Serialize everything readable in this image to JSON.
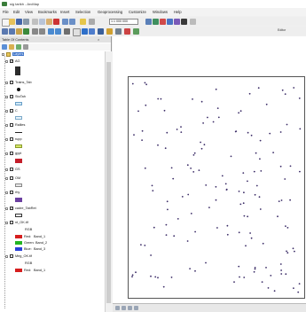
{
  "window": {
    "title": "sig tarikh - ArcMap"
  },
  "menu": [
    "File",
    "Edit",
    "View",
    "Bookmarks",
    "Insert",
    "Selection",
    "Geoprocessing",
    "Customize",
    "Windows",
    "Help"
  ],
  "toolbar": {
    "scale": "1:1 000 000",
    "editor_label": "Editor"
  },
  "toc": {
    "title": "Table Of Contents",
    "close": "×",
    "root": "Layers",
    "layers": [
      {
        "name": "AG",
        "checked": true
      },
      {
        "name": "Trains_Tab",
        "checked": false
      },
      {
        "name": "StoTah",
        "checked": false
      },
      {
        "name": "C",
        "checked": false
      },
      {
        "name": "Rallies",
        "checked": false
      },
      {
        "name": "rupp",
        "checked": false
      },
      {
        "name": "gypt",
        "checked": false
      },
      {
        "name": "GS",
        "checked": false
      },
      {
        "name": "OM",
        "checked": false
      },
      {
        "name": "rhy",
        "checked": false
      },
      {
        "name": "cadre_TabRet",
        "checked": true
      },
      {
        "name": "nt_OK.tif",
        "checked": false
      },
      {
        "name": "Meg_OK.tif",
        "checked": false
      }
    ],
    "raster1": {
      "rgb": "RGB",
      "bands": [
        {
          "label": "Red:",
          "band": "Band_1",
          "color": "#d61e1e"
        },
        {
          "label": "Green:",
          "band": "Band_2",
          "color": "#23b523"
        },
        {
          "label": "Blue:",
          "band": "Band_3",
          "color": "#2a3fd9"
        }
      ]
    },
    "raster2": {
      "rgb": "RGB",
      "bands": [
        {
          "label": "Red:",
          "band": "Band_1",
          "color": "#d61e1e"
        }
      ]
    }
  },
  "colors": {
    "points": "#3a2b66",
    "frame": "#555555",
    "toc_bg": "#ffffff"
  },
  "icons": [
    "layers-icon",
    "zoom-in-icon",
    "zoom-out-icon",
    "pan-icon",
    "identify-icon",
    "add-data-icon"
  ]
}
